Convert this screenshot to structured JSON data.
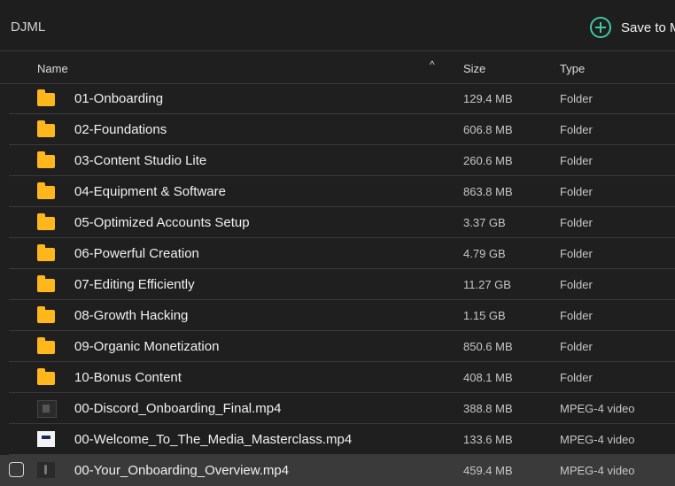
{
  "app": {
    "title": "DJML",
    "save_label": "Save to M"
  },
  "columns": {
    "name": "Name",
    "sort_indicator": "^",
    "size": "Size",
    "type": "Type"
  },
  "files": [
    {
      "name": "01-Onboarding",
      "size": "129.4 MB",
      "type": "Folder",
      "icon": "folder-icon"
    },
    {
      "name": "02-Foundations",
      "size": "606.8 MB",
      "type": "Folder",
      "icon": "folder-icon"
    },
    {
      "name": "03-Content Studio Lite",
      "size": "260.6 MB",
      "type": "Folder",
      "icon": "folder-icon"
    },
    {
      "name": "04-Equipment & Software",
      "size": "863.8 MB",
      "type": "Folder",
      "icon": "folder-icon"
    },
    {
      "name": "05-Optimized Accounts Setup",
      "size": "3.37 GB",
      "type": "Folder",
      "icon": "folder-icon"
    },
    {
      "name": "06-Powerful Creation",
      "size": "4.79 GB",
      "type": "Folder",
      "icon": "folder-icon"
    },
    {
      "name": "07-Editing Efficiently",
      "size": "11.27 GB",
      "type": "Folder",
      "icon": "folder-icon"
    },
    {
      "name": "08-Growth Hacking",
      "size": "1.15 GB",
      "type": "Folder",
      "icon": "folder-icon"
    },
    {
      "name": "09-Organic Monetization",
      "size": "850.6 MB",
      "type": "Folder",
      "icon": "folder-icon"
    },
    {
      "name": "10-Bonus Content",
      "size": "408.1 MB",
      "type": "Folder",
      "icon": "folder-icon"
    },
    {
      "name": "00-Discord_Onboarding_Final.mp4",
      "size": "388.8 MB",
      "type": "MPEG-4 video",
      "icon": "video-thumbnail-icon"
    },
    {
      "name": "00-Welcome_To_The_Media_Masterclass.mp4",
      "size": "133.6 MB",
      "type": "MPEG-4 video",
      "icon": "video-thumbnail-icon"
    },
    {
      "name": "00-Your_Onboarding_Overview.mp4",
      "size": "459.4 MB",
      "type": "MPEG-4 video",
      "icon": "video-thumbnail-icon"
    }
  ],
  "colors": {
    "folder": "#ffb71b",
    "accent": "#3ec9a0",
    "background": "#1f1f1f",
    "selected_row": "#3a3a3a"
  }
}
